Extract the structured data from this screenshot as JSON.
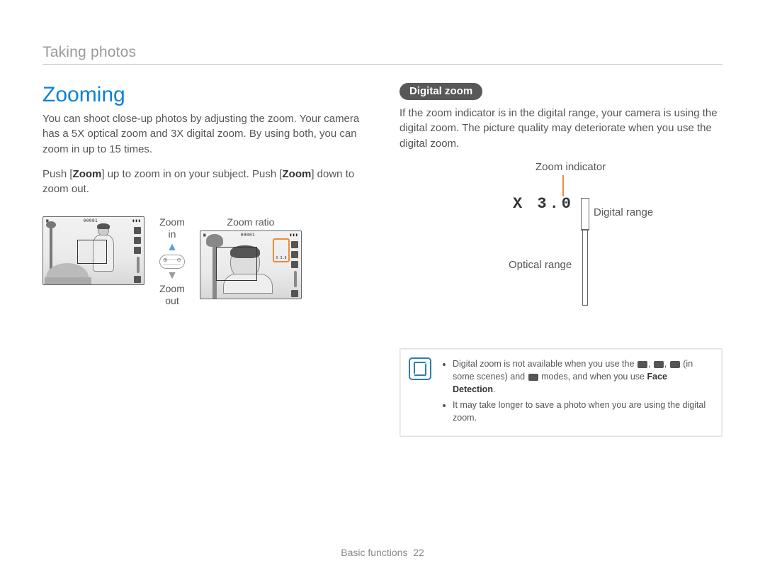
{
  "header": {
    "breadcrumb": "Taking photos"
  },
  "left": {
    "title": "Zooming",
    "p1a": "You can shoot close-up photos by adjusting the zoom. Your camera has a 5X optical zoom and 3X digital zoom. By using both, you can zoom in up to 15 times.",
    "p2_pre": "Push [",
    "p2_b1": "Zoom",
    "p2_mid": "] up to zoom in on your subject. Push [",
    "p2_b2": "Zoom",
    "p2_post": "] down to zoom out.",
    "fig": {
      "zoom_in": "Zoom\nin",
      "zoom_out": "Zoom\nout",
      "zoom_ratio": "Zoom ratio",
      "counter": "00001",
      "ratio_text": "X 3.0"
    }
  },
  "right": {
    "pill": "Digital zoom",
    "p1": "If the zoom indicator is in the digital range, your camera is using the digital zoom. The picture quality may deteriorate when you use the digital zoom.",
    "diagram": {
      "zoom_indicator": "Zoom indicator",
      "x_value": "X 3.0",
      "digital_range": "Digital range",
      "optical_range": "Optical range"
    },
    "note": {
      "li1_pre": "Digital zoom is not available when you use the ",
      "li1_post_a": ", ",
      "li1_post_b": ", ",
      "li1_post_c": " (in some scenes) and ",
      "li1_modes": " modes, and when you use ",
      "li1_fd": "Face Detection",
      "li1_end": ".",
      "li2": "It may take longer to save a photo when you are using the digital zoom."
    }
  },
  "footer": {
    "section": "Basic functions",
    "page": "22"
  }
}
